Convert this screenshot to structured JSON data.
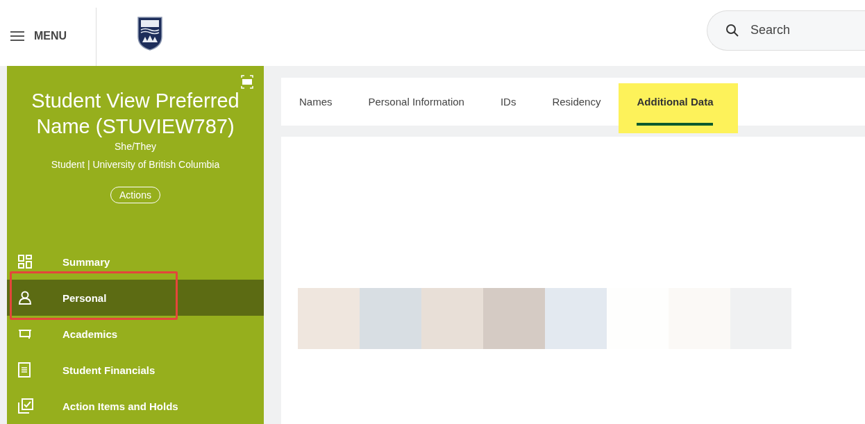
{
  "header": {
    "menu_label": "MENU",
    "search": {
      "placeholder": "Search"
    }
  },
  "profile": {
    "name": "Student View Preferred Name (STUVIEW787)",
    "pronouns": "She/They",
    "subtitle": "Student | University of British Columbia",
    "actions_button": "Actions"
  },
  "nav": [
    {
      "label": "Summary",
      "selected": false,
      "outlined": false
    },
    {
      "label": "Personal",
      "selected": true,
      "outlined": true
    },
    {
      "label": "Academics",
      "selected": false,
      "outlined": false
    },
    {
      "label": "Student Financials",
      "selected": false,
      "outlined": false
    },
    {
      "label": "Action Items and Holds",
      "selected": false,
      "outlined": false
    }
  ],
  "tabs": [
    {
      "label": "Names",
      "selected": false,
      "highlighted": false
    },
    {
      "label": "Personal Information",
      "selected": false,
      "highlighted": false
    },
    {
      "label": "IDs",
      "selected": false,
      "highlighted": false
    },
    {
      "label": "Residency",
      "selected": false,
      "highlighted": false
    },
    {
      "label": "Additional Data",
      "selected": true,
      "highlighted": true
    }
  ]
}
